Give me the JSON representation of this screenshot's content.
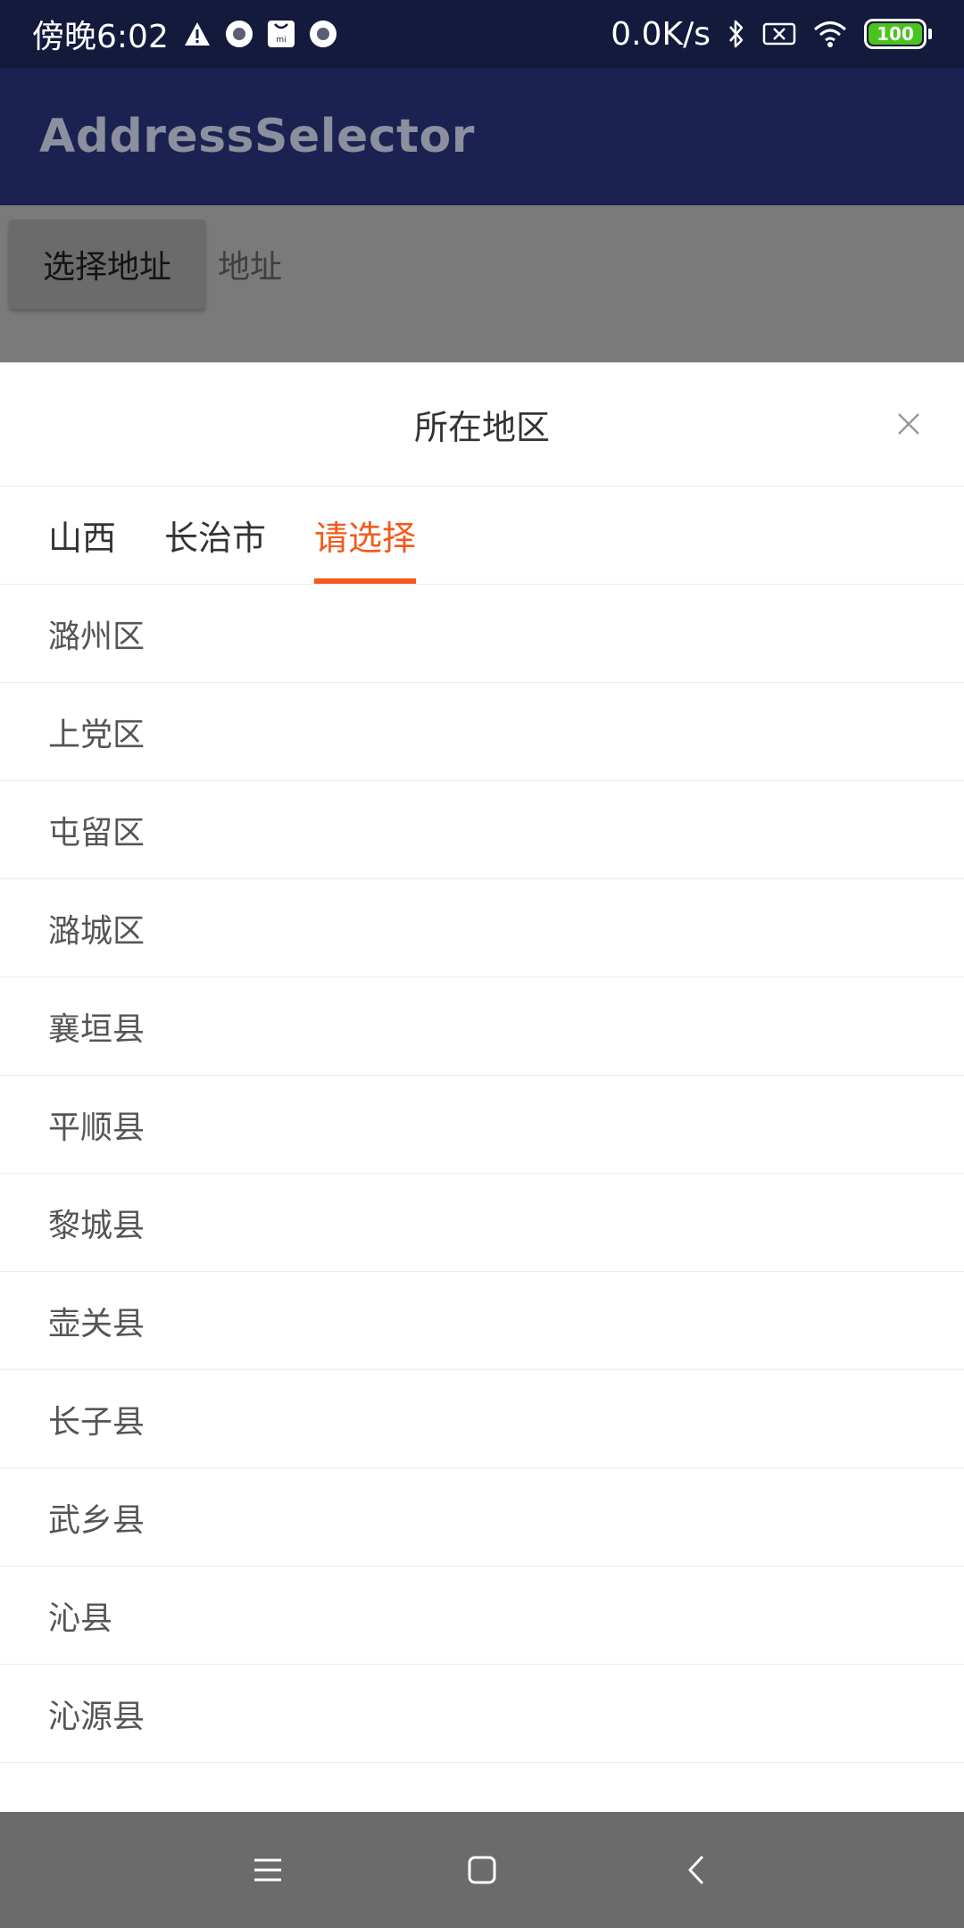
{
  "status_bar": {
    "time": "傍晚6:02",
    "speed": "0.0K/s",
    "battery": "100",
    "icons": [
      "warning-icon",
      "notification-dot-icon",
      "mi-icon",
      "notification-dot-icon",
      "bluetooth-icon",
      "sim-icon",
      "wifi-icon",
      "battery-icon"
    ]
  },
  "app_bar": {
    "title": "AddressSelector"
  },
  "content": {
    "select_button": "选择地址",
    "address_label": "地址"
  },
  "sheet": {
    "title": "所在地区",
    "close_icon": "close-icon",
    "tabs": [
      {
        "label": "山西",
        "active": false
      },
      {
        "label": "长治市",
        "active": false
      },
      {
        "label": "请选择",
        "active": true
      }
    ],
    "items": [
      "潞州区",
      "上党区",
      "屯留区",
      "潞城区",
      "襄垣县",
      "平顺县",
      "黎城县",
      "壶关县",
      "长子县",
      "武乡县",
      "沁县",
      "沁源县"
    ]
  },
  "nav_bar": {
    "icons": [
      "menu-icon",
      "home-icon",
      "back-icon"
    ]
  },
  "colors": {
    "accent": "#f25a1b",
    "status_bar": "#131a3c",
    "app_bar": "#1b2252",
    "battery": "#49c41e"
  }
}
